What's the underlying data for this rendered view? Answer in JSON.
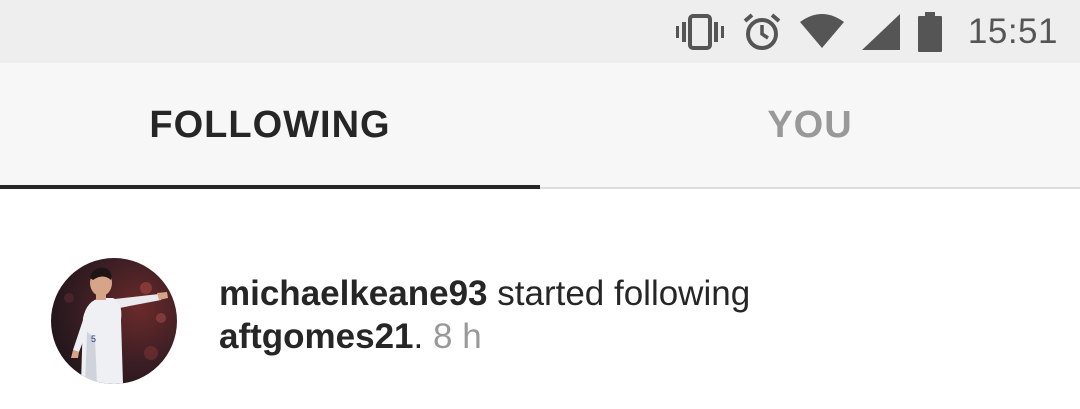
{
  "status_bar": {
    "time": "15:51",
    "icons": [
      "vibrate-icon",
      "alarm-icon",
      "wifi-icon",
      "signal-icon",
      "battery-icon"
    ]
  },
  "tabs": [
    {
      "label": "FOLLOWING",
      "active": true
    },
    {
      "label": "YOU",
      "active": false
    }
  ],
  "activity": [
    {
      "actor": "michaelkeane93",
      "action": "started following",
      "target": "aftgomes21",
      "separator": ".",
      "time": "8 h"
    }
  ]
}
